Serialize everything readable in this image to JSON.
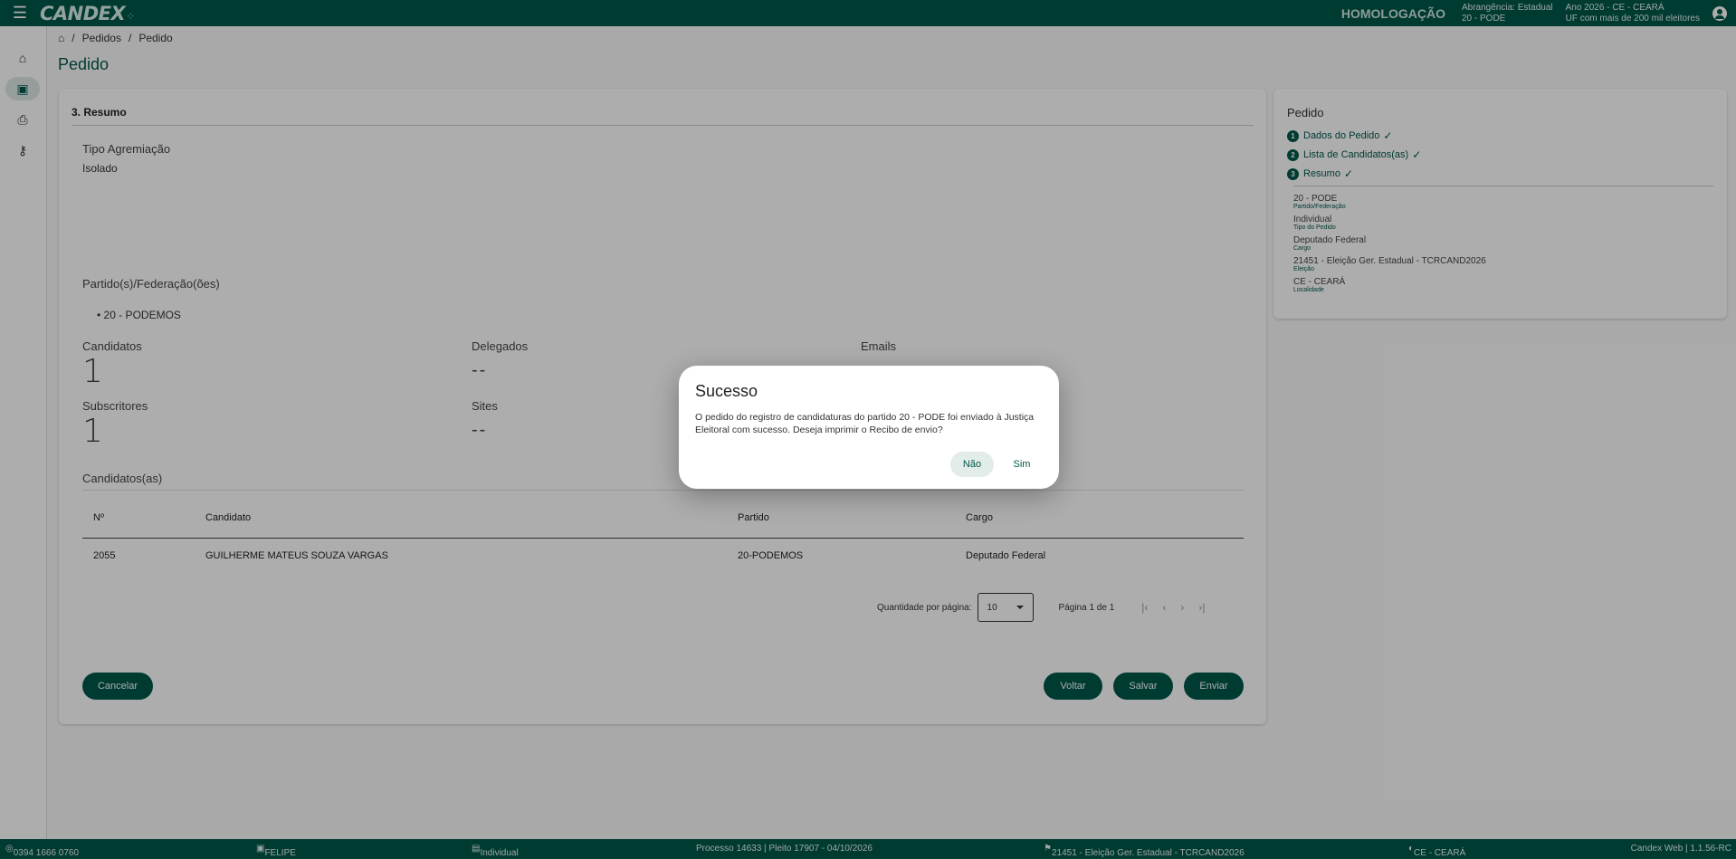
{
  "topbar": {
    "logo": "CANDEX",
    "environment": "HOMOLOGAÇÃO",
    "scope_line1": "Abrangência: Estadual",
    "scope_line2": "20 - PODE",
    "year_line1": "Ano 2026 - CE - CEARÁ",
    "year_line2": "UF com mais de 200 mil eleitores"
  },
  "breadcrumb": {
    "item1": "Pedidos",
    "item2": "Pedido"
  },
  "page_title": "Pedido",
  "summary": {
    "section_title": "3. Resumo",
    "tipo_agremiacao_label": "Tipo Agremiação",
    "tipo_agremiacao_value": "Isolado",
    "partidos_label": "Partido(s)/Federação(ões)",
    "partidos": [
      "20 - PODEMOS"
    ],
    "candidatos_label": "Candidatos",
    "candidatos_value": "1",
    "delegados_label": "Delegados",
    "delegados_value": "--",
    "emails_label": "Emails",
    "subscritores_label": "Subscritores",
    "subscritores_value": "1",
    "sites_label": "Sites",
    "sites_value": "--",
    "candidatos_table_label": "Candidatos(as)"
  },
  "table": {
    "headers": [
      "Nº",
      "Candidato",
      "Partido",
      "Cargo"
    ],
    "rows": [
      [
        "2055",
        "GUILHERME MATEUS SOUZA VARGAS",
        "20-PODEMOS",
        "Deputado Federal"
      ]
    ]
  },
  "paginator": {
    "items_label": "Quantidade por página:",
    "page_size": "10",
    "range": "Página 1 de 1"
  },
  "buttons": {
    "cancel": "Cancelar",
    "back": "Voltar",
    "save": "Salvar",
    "send": "Enviar"
  },
  "side": {
    "title": "Pedido",
    "steps": [
      {
        "num": "1",
        "label": "Dados do Pedido"
      },
      {
        "num": "2",
        "label": "Lista de Candidatos(as)"
      },
      {
        "num": "3",
        "label": "Resumo"
      }
    ],
    "items": [
      {
        "value": "20 - PODE",
        "label": "Partido/Federação"
      },
      {
        "value": "Individual",
        "label": "Tipo do Pedido"
      },
      {
        "value": "Deputado Federal",
        "label": "Cargo"
      },
      {
        "value": "21451 - Eleição Ger. Estadual - TCRCAND2026",
        "label": "Eleição"
      },
      {
        "value": "CE - CEARÁ",
        "label": "Localidade"
      }
    ]
  },
  "footer": {
    "phone": "0394 1666 0760",
    "user": "FELIPE",
    "type": "Individual",
    "process": "Processo 14633 | Pleito 17907 - 04/10/2026",
    "election": "21451 - Eleição Ger. Estadual - TCRCAND2026",
    "location": "CE - CEARÁ",
    "version": "Candex Web | 1.1.56-RC"
  },
  "dialog": {
    "title": "Sucesso",
    "message": "O pedido do registro de candidaturas do partido 20 - PODE foi enviado à Justiça Eleitoral com sucesso. Deseja imprimir o Recibo de envio?",
    "no": "Não",
    "yes": "Sim"
  }
}
